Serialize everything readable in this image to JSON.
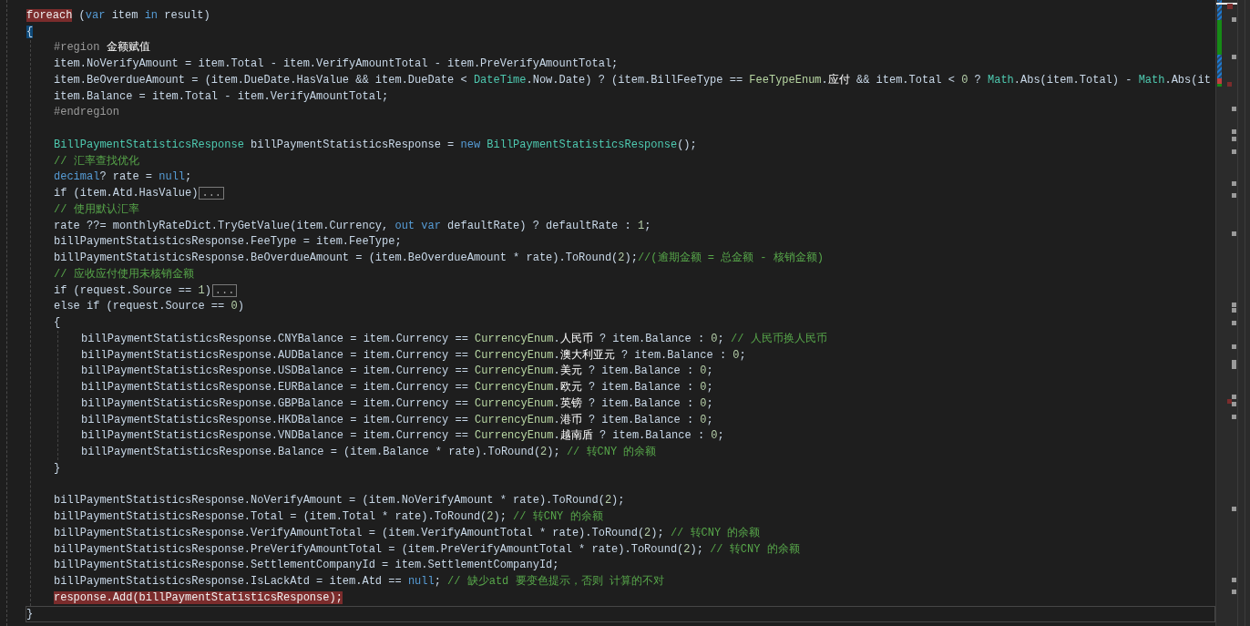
{
  "editor": {
    "lines": [
      {
        "current": false,
        "tokens": [
          {
            "text": "foreach",
            "kind": "flagged"
          },
          {
            "text": " (",
            "kind": "text"
          },
          {
            "text": "var",
            "kind": "kw"
          },
          {
            "text": " item ",
            "kind": "text"
          },
          {
            "text": "in",
            "kind": "kw"
          },
          {
            "text": " result)",
            "kind": "text"
          }
        ]
      },
      {
        "current": false,
        "tokens": [
          {
            "text": "{",
            "kind": "brace"
          }
        ],
        "children": [
          {
            "current": false,
            "tokens": [
              {
                "text": "#region",
                "kind": "preproc"
              },
              {
                "text": " 金额赋值",
                "kind": "member"
              }
            ]
          },
          {
            "current": false,
            "tokens": [
              {
                "text": "item.NoVerifyAmount = item.Total - item.VerifyAmountTotal - item.PreVerifyAmountTotal;",
                "kind": "text"
              }
            ]
          },
          {
            "current": false,
            "tokens": [
              {
                "text": "item.BeOverdueAmount = (item.DueDate.HasValue && item.DueDate < ",
                "kind": "text"
              },
              {
                "text": "DateTime",
                "kind": "type"
              },
              {
                "text": ".Now.Date) ? (item.BillFeeType == ",
                "kind": "text"
              },
              {
                "text": "FeeTypeEnum",
                "kind": "enum"
              },
              {
                "text": ".",
                "kind": "text"
              },
              {
                "text": "应付",
                "kind": "member"
              },
              {
                "text": " && item.Total < ",
                "kind": "text"
              },
              {
                "text": "0",
                "kind": "num"
              },
              {
                "text": " ? ",
                "kind": "text"
              },
              {
                "text": "Math",
                "kind": "type"
              },
              {
                "text": ".Abs(item.Total) - ",
                "kind": "text"
              },
              {
                "text": "Math",
                "kind": "type"
              },
              {
                "text": ".Abs(it",
                "kind": "text"
              }
            ]
          },
          {
            "current": false,
            "tokens": [
              {
                "text": "item.Balance = item.Total - item.VerifyAmountTotal;",
                "kind": "text"
              }
            ]
          },
          {
            "current": false,
            "tokens": [
              {
                "text": "#endregion",
                "kind": "preproc"
              }
            ]
          },
          {
            "current": false
          },
          {
            "current": false,
            "tokens": [
              {
                "text": "BillPaymentStatisticsResponse",
                "kind": "type"
              },
              {
                "text": " billPaymentStatisticsResponse = ",
                "kind": "text"
              },
              {
                "text": "new",
                "kind": "kw"
              },
              {
                "text": " BillPaymentStatisticsResponse",
                "kind": "type"
              },
              {
                "text": "();",
                "kind": "text"
              }
            ]
          },
          {
            "current": false,
            "tokens": [
              {
                "text": "// 汇率查找优化",
                "kind": "comment"
              }
            ]
          },
          {
            "current": false,
            "tokens": [
              {
                "text": "decimal",
                "kind": "kw"
              },
              {
                "text": "? rate = ",
                "kind": "text"
              },
              {
                "text": "null",
                "kind": "kw"
              },
              {
                "text": ";",
                "kind": "text"
              }
            ]
          },
          {
            "current": false,
            "tokens": [
              {
                "text": "if (item.Atd.HasValue)",
                "kind": "text"
              },
              {
                "text": "...",
                "kind": "fold"
              }
            ]
          },
          {
            "current": false,
            "tokens": [
              {
                "text": "// 使用默认汇率",
                "kind": "comment"
              }
            ]
          },
          {
            "current": false,
            "tokens": [
              {
                "text": "rate ??= monthlyRateDict.TryGetValue(item.Currency, ",
                "kind": "text"
              },
              {
                "text": "out var",
                "kind": "kw"
              },
              {
                "text": " defaultRate) ? defaultRate : ",
                "kind": "text"
              },
              {
                "text": "1",
                "kind": "num"
              },
              {
                "text": ";",
                "kind": "text"
              }
            ]
          },
          {
            "current": false,
            "tokens": [
              {
                "text": "billPaymentStatisticsResponse.FeeType = item.FeeType;",
                "kind": "text"
              }
            ]
          },
          {
            "current": false,
            "tokens": [
              {
                "text": "billPaymentStatisticsResponse.BeOverdueAmount = (item.BeOverdueAmount * rate).ToRound(",
                "kind": "text"
              },
              {
                "text": "2",
                "kind": "num"
              },
              {
                "text": ");",
                "kind": "text"
              },
              {
                "text": "//(逾期金额 = 总金额 - 核销金额)",
                "kind": "comment"
              }
            ]
          },
          {
            "current": false,
            "tokens": [
              {
                "text": "// 应收应付使用未核销金额",
                "kind": "comment"
              }
            ]
          },
          {
            "current": false,
            "tokens": [
              {
                "text": "if (request.Source == ",
                "kind": "text"
              },
              {
                "text": "1",
                "kind": "num"
              },
              {
                "text": ")",
                "kind": "text"
              },
              {
                "text": "...",
                "kind": "fold"
              }
            ]
          },
          {
            "current": false,
            "tokens": [
              {
                "text": "else if (request.Source == ",
                "kind": "text"
              },
              {
                "text": "0",
                "kind": "num"
              },
              {
                "text": ")",
                "kind": "text"
              }
            ]
          },
          {
            "current": false,
            "tokens": [
              {
                "text": "{",
                "kind": "text"
              }
            ],
            "children": [
              {
                "current": false,
                "tokens": [
                  {
                    "text": "billPaymentStatisticsResponse.CNYBalance = item.Currency == ",
                    "kind": "text"
                  },
                  {
                    "text": "CurrencyEnum",
                    "kind": "enum"
                  },
                  {
                    "text": ".",
                    "kind": "text"
                  },
                  {
                    "text": "人民币",
                    "kind": "member"
                  },
                  {
                    "text": " ? item.Balance : ",
                    "kind": "text"
                  },
                  {
                    "text": "0",
                    "kind": "num"
                  },
                  {
                    "text": "; ",
                    "kind": "text"
                  },
                  {
                    "text": "// 人民币换人民币",
                    "kind": "comment"
                  }
                ]
              },
              {
                "current": false,
                "tokens": [
                  {
                    "text": "billPaymentStatisticsResponse.AUDBalance = item.Currency == ",
                    "kind": "text"
                  },
                  {
                    "text": "CurrencyEnum",
                    "kind": "enum"
                  },
                  {
                    "text": ".",
                    "kind": "text"
                  },
                  {
                    "text": "澳大利亚元",
                    "kind": "member"
                  },
                  {
                    "text": " ? item.Balance : ",
                    "kind": "text"
                  },
                  {
                    "text": "0",
                    "kind": "num"
                  },
                  {
                    "text": ";",
                    "kind": "text"
                  }
                ]
              },
              {
                "current": false,
                "tokens": [
                  {
                    "text": "billPaymentStatisticsResponse.USDBalance = item.Currency == ",
                    "kind": "text"
                  },
                  {
                    "text": "CurrencyEnum",
                    "kind": "enum"
                  },
                  {
                    "text": ".",
                    "kind": "text"
                  },
                  {
                    "text": "美元",
                    "kind": "member"
                  },
                  {
                    "text": " ? item.Balance : ",
                    "kind": "text"
                  },
                  {
                    "text": "0",
                    "kind": "num"
                  },
                  {
                    "text": ";",
                    "kind": "text"
                  }
                ]
              },
              {
                "current": false,
                "tokens": [
                  {
                    "text": "billPaymentStatisticsResponse.EURBalance = item.Currency == ",
                    "kind": "text"
                  },
                  {
                    "text": "CurrencyEnum",
                    "kind": "enum"
                  },
                  {
                    "text": ".",
                    "kind": "text"
                  },
                  {
                    "text": "欧元",
                    "kind": "member"
                  },
                  {
                    "text": " ? item.Balance : ",
                    "kind": "text"
                  },
                  {
                    "text": "0",
                    "kind": "num"
                  },
                  {
                    "text": ";",
                    "kind": "text"
                  }
                ]
              },
              {
                "current": false,
                "tokens": [
                  {
                    "text": "billPaymentStatisticsResponse.GBPBalance = item.Currency == ",
                    "kind": "text"
                  },
                  {
                    "text": "CurrencyEnum",
                    "kind": "enum"
                  },
                  {
                    "text": ".",
                    "kind": "text"
                  },
                  {
                    "text": "英镑",
                    "kind": "member"
                  },
                  {
                    "text": " ? item.Balance : ",
                    "kind": "text"
                  },
                  {
                    "text": "0",
                    "kind": "num"
                  },
                  {
                    "text": ";",
                    "kind": "text"
                  }
                ]
              },
              {
                "current": false,
                "tokens": [
                  {
                    "text": "billPaymentStatisticsResponse.HKDBalance = item.Currency == ",
                    "kind": "text"
                  },
                  {
                    "text": "CurrencyEnum",
                    "kind": "enum"
                  },
                  {
                    "text": ".",
                    "kind": "text"
                  },
                  {
                    "text": "港币",
                    "kind": "member"
                  },
                  {
                    "text": " ? item.Balance : ",
                    "kind": "text"
                  },
                  {
                    "text": "0",
                    "kind": "num"
                  },
                  {
                    "text": ";",
                    "kind": "text"
                  }
                ]
              },
              {
                "current": false,
                "tokens": [
                  {
                    "text": "billPaymentStatisticsResponse.VNDBalance = item.Currency == ",
                    "kind": "text"
                  },
                  {
                    "text": "CurrencyEnum",
                    "kind": "enum"
                  },
                  {
                    "text": ".",
                    "kind": "text"
                  },
                  {
                    "text": "越南盾",
                    "kind": "member"
                  },
                  {
                    "text": " ? item.Balance : ",
                    "kind": "text"
                  },
                  {
                    "text": "0",
                    "kind": "num"
                  },
                  {
                    "text": ";",
                    "kind": "text"
                  }
                ]
              },
              {
                "current": false,
                "tokens": [
                  {
                    "text": "billPaymentStatisticsResponse.Balance = (item.Balance * rate).ToRound(",
                    "kind": "text"
                  },
                  {
                    "text": "2",
                    "kind": "num"
                  },
                  {
                    "text": "); ",
                    "kind": "text"
                  },
                  {
                    "text": "// 转CNY 的余额",
                    "kind": "comment"
                  }
                ]
              }
            ]
          },
          {
            "current": false,
            "tokens": [
              {
                "text": "}",
                "kind": "text"
              }
            ]
          },
          {
            "current": false
          },
          {
            "current": false,
            "tokens": [
              {
                "text": "billPaymentStatisticsResponse.NoVerifyAmount = (item.NoVerifyAmount * rate).ToRound(",
                "kind": "text"
              },
              {
                "text": "2",
                "kind": "num"
              },
              {
                "text": ");",
                "kind": "text"
              }
            ]
          },
          {
            "current": false,
            "tokens": [
              {
                "text": "billPaymentStatisticsResponse.Total = (item.Total * rate).ToRound(",
                "kind": "text"
              },
              {
                "text": "2",
                "kind": "num"
              },
              {
                "text": "); ",
                "kind": "text"
              },
              {
                "text": "// 转CNY 的余额",
                "kind": "comment"
              }
            ]
          },
          {
            "current": false,
            "tokens": [
              {
                "text": "billPaymentStatisticsResponse.VerifyAmountTotal = (item.VerifyAmountTotal * rate).ToRound(",
                "kind": "text"
              },
              {
                "text": "2",
                "kind": "num"
              },
              {
                "text": "); ",
                "kind": "text"
              },
              {
                "text": "// 转CNY 的余额",
                "kind": "comment"
              }
            ]
          },
          {
            "current": false,
            "tokens": [
              {
                "text": "billPaymentStatisticsResponse.PreVerifyAmountTotal = (item.PreVerifyAmountTotal * rate).ToRound(",
                "kind": "text"
              },
              {
                "text": "2",
                "kind": "num"
              },
              {
                "text": "); ",
                "kind": "text"
              },
              {
                "text": "// 转CNY 的余额",
                "kind": "comment"
              }
            ]
          },
          {
            "current": false,
            "tokens": [
              {
                "text": "billPaymentStatisticsResponse.SettlementCompanyId = item.SettlementCompanyId;",
                "kind": "text"
              }
            ]
          },
          {
            "current": false,
            "tokens": [
              {
                "text": "billPaymentStatisticsResponse.IsLackAtd = item.Atd == ",
                "kind": "text"
              },
              {
                "text": "null",
                "kind": "kw"
              },
              {
                "text": "; ",
                "kind": "text"
              },
              {
                "text": "// 缺少atd 要变色提示，否则 计算的不对",
                "kind": "comment"
              }
            ]
          },
          {
            "current": false,
            "tokens": [
              {
                "text": "response.Add(billPaymentStatisticsResponse);",
                "kind": "flagged"
              }
            ]
          }
        ]
      },
      {
        "current": true,
        "tokens": [
          {
            "text": "}",
            "kind": "text"
          }
        ]
      }
    ]
  }
}
